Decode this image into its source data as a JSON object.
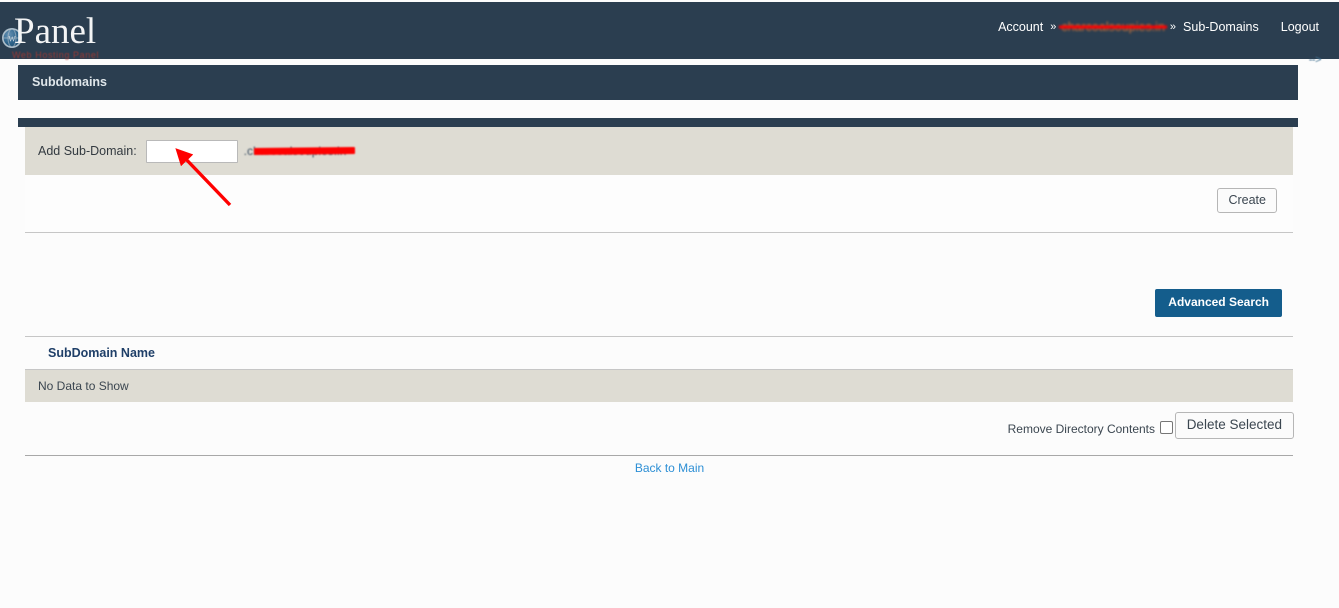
{
  "brand": {
    "name": "Panel",
    "tagline": "Web Hosting Panel",
    "globe_icon": "globe-icon"
  },
  "nav": {
    "account_label": "Account",
    "separator": "»",
    "domain_label": "charcoalsoupies.in",
    "subdomains_label": "Sub-Domains",
    "logout_label": "Logout"
  },
  "artifact": {
    "text": "-->"
  },
  "page": {
    "title": "Subdomains"
  },
  "add_form": {
    "label": "Add Sub-Domain:",
    "input_value": "",
    "input_placeholder": "",
    "domain_suffix": ".charcoalsoupies.in",
    "create_label": "Create"
  },
  "search": {
    "advanced_label": "Advanced Search"
  },
  "table": {
    "columns": [
      "SubDomain Name"
    ],
    "rows": [],
    "empty_message": "No Data to Show"
  },
  "footer": {
    "remove_dir_label": "Remove Directory Contents",
    "remove_dir_checked": false,
    "delete_label": "Delete Selected",
    "back_label": "Back to Main"
  },
  "colors": {
    "navy": "#2b3e50",
    "beige": "#dedcd3",
    "accent_blue": "#145d8c",
    "link_blue": "#2d8fd5",
    "annotation_red": "#ff0000"
  }
}
